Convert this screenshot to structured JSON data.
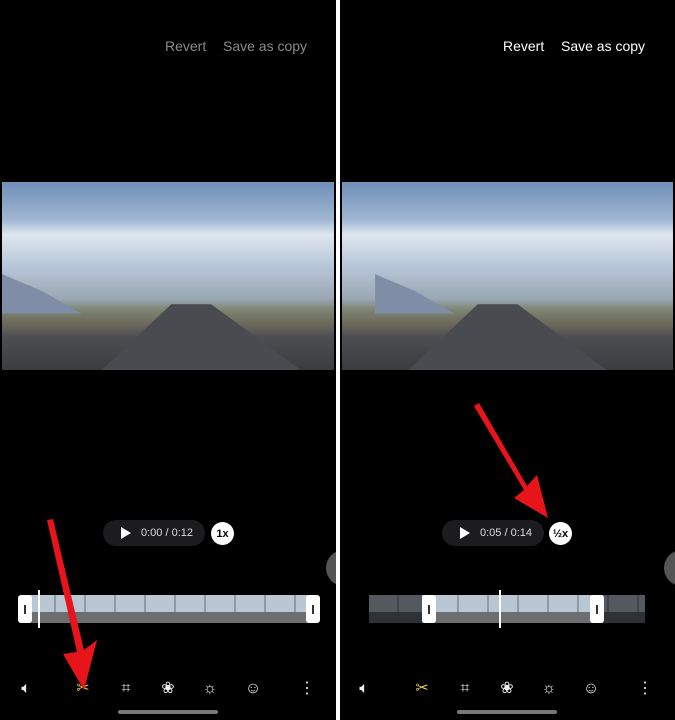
{
  "left": {
    "header": {
      "revert": "Revert",
      "save_as_copy": "Save as copy",
      "enabled": false
    },
    "player": {
      "time": "0:00 / 0:12",
      "speed": "1x"
    },
    "tools": [
      "volume-icon",
      "trim-icon",
      "transform-icon",
      "filter-icon",
      "adjust-icon",
      "sticker-icon",
      "more-icon"
    ],
    "active_tool": "trim-icon"
  },
  "right": {
    "header": {
      "revert": "Revert",
      "save_as_copy": "Save as copy",
      "enabled": true
    },
    "player": {
      "time": "0:05 / 0:14",
      "speed": "½x"
    },
    "tools": [
      "volume-icon",
      "trim-icon",
      "transform-icon",
      "filter-icon",
      "adjust-icon",
      "sticker-icon",
      "more-icon"
    ],
    "active_tool": "trim-icon"
  },
  "colors": {
    "active_tool": "#e8c25a",
    "disabled_text": "#8a8a8a",
    "arrow": "#e8141b"
  }
}
